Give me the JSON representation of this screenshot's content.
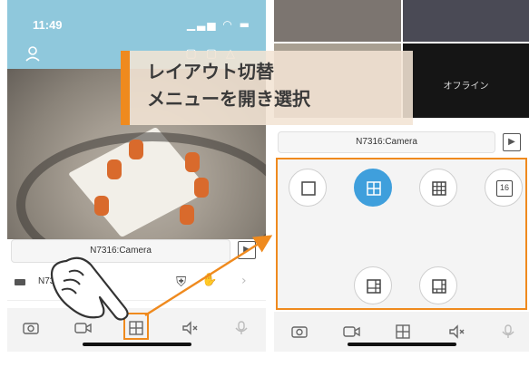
{
  "left_phone": {
    "status": {
      "time": "11:49",
      "icons": "all ≋ ▬"
    },
    "camera": {
      "name": "N7316:Camera"
    },
    "device": {
      "name": "N73"
    },
    "toolbar": {
      "icons": [
        "camera-icon",
        "video-icon",
        "layout-icon",
        "mute-icon",
        "mic-icon"
      ]
    }
  },
  "right_phone": {
    "grid": {
      "offline_label": "オフライン"
    },
    "camera": {
      "name": "N7316:Camera"
    },
    "layouts": [
      {
        "name": "single-layout",
        "glyph": "☐",
        "selected": false
      },
      {
        "name": "quad-layout",
        "glyph": "⊞",
        "selected": true
      },
      {
        "name": "nine-layout",
        "glyph": "▦",
        "selected": false
      },
      {
        "name": "sixteen-layout",
        "glyph": "16",
        "selected": false
      },
      {
        "name": "one-plus-three-layout",
        "glyph": "◫",
        "selected": false
      },
      {
        "name": "one-plus-five-layout",
        "glyph": "◫",
        "selected": false
      }
    ]
  },
  "callout": {
    "line1": "レイアウト切替",
    "line2": "メニューを開き選択",
    "accent_color": "#ef8a1e"
  }
}
